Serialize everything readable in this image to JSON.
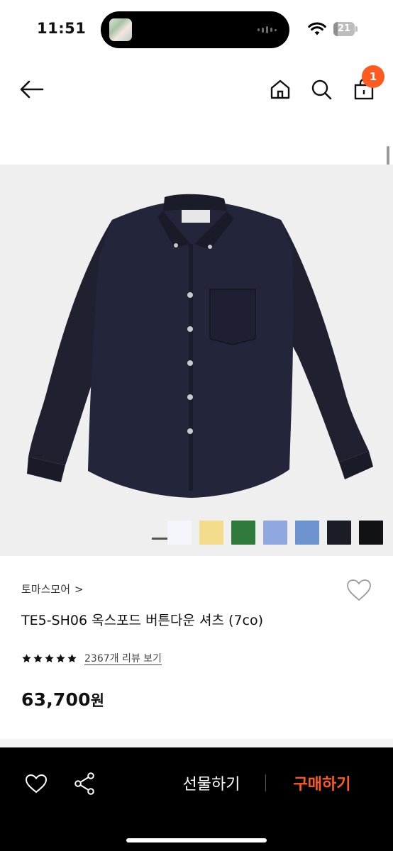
{
  "status_bar": {
    "time": "11:51",
    "battery_percent": "21",
    "battery_level": 0.21,
    "island_thumbnail": "album-art",
    "wifi_icon": "wifi-icon"
  },
  "header": {
    "back_icon": "arrow-left-icon",
    "home_icon": "home-icon",
    "search_icon": "search-icon",
    "cart_icon": "shopping-bag-icon",
    "cart_count": "1",
    "cart_badge_color": "#ff5a1f"
  },
  "product": {
    "image_description_icon": "shirt-image",
    "color_swatches": [
      "#f4f6fb",
      "#f3dc8b",
      "#2f7a3c",
      "#8fa8df",
      "#6d93d1",
      "#1a1c26",
      "#111216"
    ],
    "brand": "토마스모어",
    "brand_chevron": ">",
    "title": "TE5-SH06 옥스포드 버튼다운 셔츠 (7co)",
    "rating": 5,
    "rating_max": 5,
    "review_link": "2367개 리뷰 보기",
    "price": "63,700",
    "price_unit": "원"
  },
  "bottom_bar": {
    "wishlist_icon": "heart-icon",
    "share_icon": "share-icon",
    "gift_label": "선물하기",
    "buy_label": "구매하기",
    "buy_color": "#ff5a1f"
  }
}
